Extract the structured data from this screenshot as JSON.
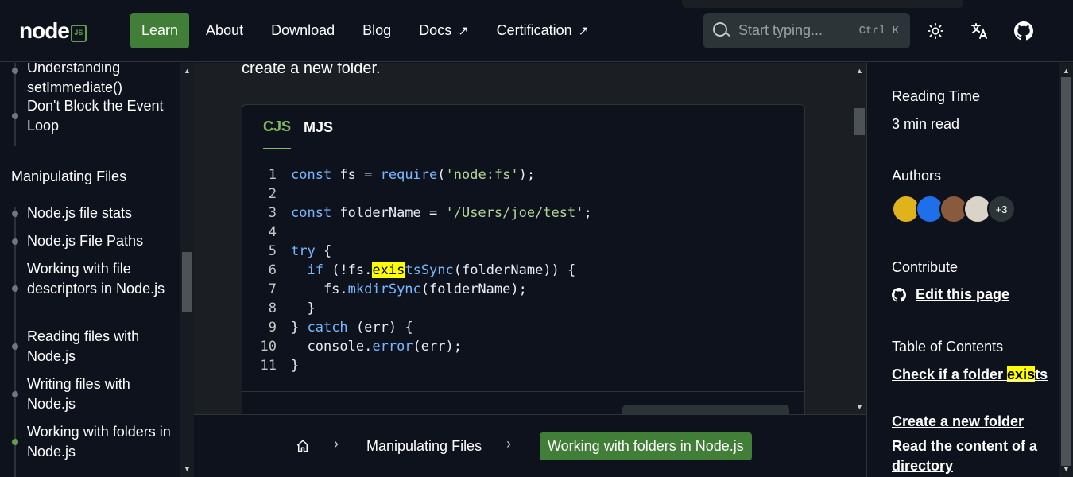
{
  "logo": {
    "text": "node",
    "badge": "JS"
  },
  "nav": [
    {
      "label": "Learn",
      "active": true,
      "external": false
    },
    {
      "label": "About",
      "active": false,
      "external": false
    },
    {
      "label": "Download",
      "active": false,
      "external": false
    },
    {
      "label": "Blog",
      "active": false,
      "external": false
    },
    {
      "label": "Docs",
      "active": false,
      "external": true
    },
    {
      "label": "Certification",
      "active": false,
      "external": true
    }
  ],
  "external_glyph": "↗",
  "search": {
    "placeholder": "Start typing...",
    "shortcut": "Ctrl K"
  },
  "sidebar": {
    "items_top": [
      {
        "label": "Understanding setImmediate()"
      },
      {
        "label": "Don't Block the Event Loop"
      }
    ],
    "category": "Manipulating Files",
    "items": [
      {
        "label": "Node.js file stats"
      },
      {
        "label": "Node.js File Paths"
      },
      {
        "label": "Working with file descriptors in Node.js"
      },
      {
        "label": "Reading files with Node.js"
      },
      {
        "label": "Writing files with Node.js"
      },
      {
        "label": "Working with folders in Node.js",
        "active": true
      }
    ]
  },
  "main": {
    "intro": "create a new folder.",
    "tabs": [
      "CJS",
      "MJS"
    ],
    "active_tab": "CJS"
  },
  "breadcrumb": {
    "category": "Manipulating Files",
    "current": "Working with folders in Node.js"
  },
  "right": {
    "reading_time_label": "Reading Time",
    "reading_time_value": "3 min read",
    "authors_label": "Authors",
    "authors_more": "+3",
    "contribute_label": "Contribute",
    "edit_link": "Edit this page",
    "toc_label": "Table of Contents",
    "toc": [
      "Check if a folder exists",
      "Create a new folder",
      "Read the content of a directory"
    ]
  },
  "colors": {
    "accent": "#417e38",
    "highlight": "#ffff00",
    "code_keyword": "#79b8ff",
    "code_string": "#b4d699"
  }
}
